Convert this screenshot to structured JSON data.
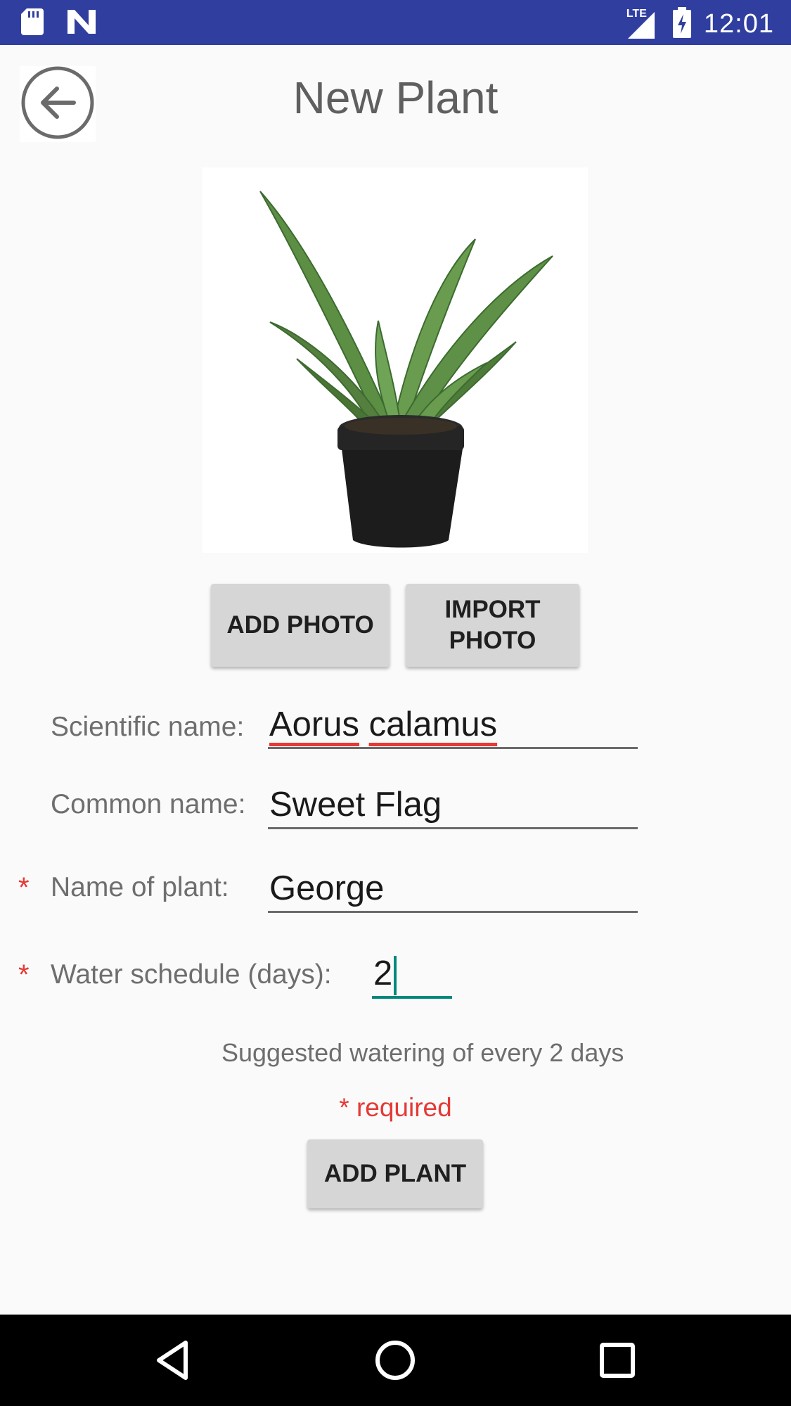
{
  "status_bar": {
    "time": "12:01",
    "network_label": "LTE",
    "icons": [
      "sd-card-icon",
      "n-app-icon",
      "signal-icon",
      "battery-charging-icon"
    ]
  },
  "header": {
    "title": "New Plant",
    "back_icon": "back-arrow-circle-icon"
  },
  "photo": {
    "subject": "potted aloe plant",
    "add_photo_label": "ADD PHOTO",
    "import_photo_label": "IMPORT\nPHOTO"
  },
  "form": {
    "scientific_name": {
      "label": "Scientific name:",
      "value": "Aorus calamus",
      "words": [
        "Aorus",
        "calamus"
      ]
    },
    "common_name": {
      "label": "Common name:",
      "value": "Sweet Flag"
    },
    "plant_name": {
      "label": "Name of plant:",
      "value": "George",
      "required_mark": "*"
    },
    "water_schedule": {
      "label": "Water schedule (days):",
      "value": "2",
      "required_mark": "*"
    },
    "hint": "Suggested watering of every 2 days",
    "required_note": "* required",
    "submit_label": "ADD PLANT"
  },
  "colors": {
    "status_bar": "#303f9f",
    "accent": "#00897b",
    "required": "#e53935",
    "button": "#d6d6d6"
  },
  "nav_bar": {
    "icons": [
      "back-triangle-icon",
      "home-circle-icon",
      "recents-square-icon"
    ]
  }
}
